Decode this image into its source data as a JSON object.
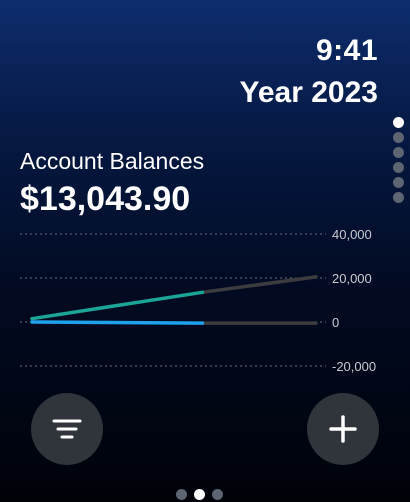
{
  "status": {
    "time": "9:41"
  },
  "header": {
    "subtitle": "Year 2023"
  },
  "pagination_vertical": {
    "count": 6,
    "active_index": 0
  },
  "summary": {
    "title": "Account Balances",
    "total": "$13,043.90"
  },
  "chart_data": {
    "type": "line",
    "title": "",
    "ylim": [
      -20000,
      40000
    ],
    "y_ticks": [
      "40,000",
      "20,000",
      "0",
      "-20,000"
    ],
    "y_tick_values": [
      40000,
      20000,
      0,
      -20000
    ],
    "grid": true,
    "series": [
      {
        "color": "#1aa597",
        "projection_color": "#3c3c3e",
        "points": [
          [
            0,
            1500
          ],
          [
            0.6,
            13500
          ]
        ],
        "projection": [
          [
            0.6,
            13500
          ],
          [
            1.0,
            20500
          ]
        ]
      },
      {
        "color": "#1fa2ee",
        "projection_color": "#3c3c3e",
        "points": [
          [
            0,
            0
          ],
          [
            0.6,
            -500
          ]
        ],
        "projection": [
          [
            0.6,
            -500
          ],
          [
            1.0,
            -500
          ]
        ]
      }
    ]
  },
  "actions": {
    "filter_icon": "filter-lines-icon",
    "add_icon": "plus-icon"
  },
  "pagination_horizontal": {
    "count": 3,
    "active_index": 1
  },
  "colors": {
    "bg_top": "#0e2d6e",
    "bg_bottom": "#000208",
    "button": "#30343b",
    "teal": "#1aa597",
    "blue": "#1fa2ee"
  }
}
